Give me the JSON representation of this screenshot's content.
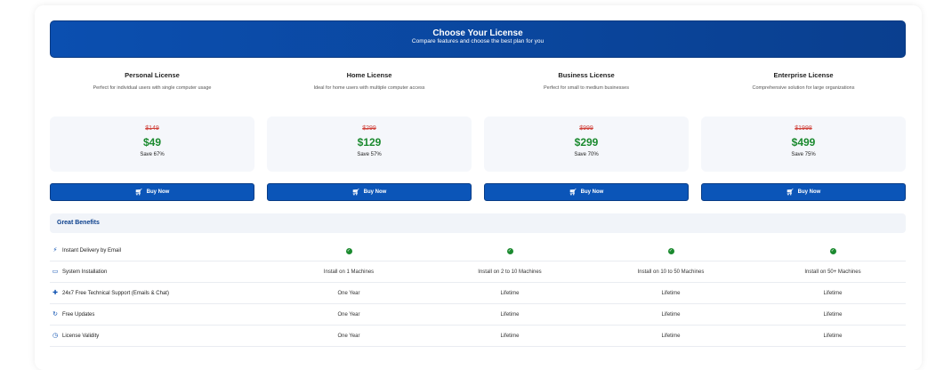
{
  "header": {
    "title": "Choose Your License",
    "subtitle": "Compare features and choose the best plan for you"
  },
  "plans": [
    {
      "name": "Personal License",
      "desc": "Perfect for individual users with single computer usage",
      "old_price": "$149",
      "price": "$49",
      "save": "Save 67%",
      "button": "Buy Now"
    },
    {
      "name": "Home License",
      "desc": "Ideal for home users with multiple computer access",
      "old_price": "$299",
      "price": "$129",
      "save": "Save 57%",
      "button": "Buy Now"
    },
    {
      "name": "Business License",
      "desc": "Perfect for small to medium businesses",
      "old_price": "$999",
      "price": "$299",
      "save": "Save 70%",
      "button": "Buy Now"
    },
    {
      "name": "Enterprise License",
      "desc": "Comprehensive solution for large organizations",
      "old_price": "$1998",
      "price": "$499",
      "save": "Save 75%",
      "button": "Buy Now"
    }
  ],
  "benefits": {
    "title": "Great Benefits",
    "rows": [
      {
        "icon": "bolt-icon",
        "label": "Instant Delivery by Email",
        "values": [
          "check",
          "check",
          "check",
          "check"
        ]
      },
      {
        "icon": "monitor-icon",
        "label": "System Installation",
        "values": [
          "Install on 1 Machines",
          "Install on 2 to 10 Machines",
          "Install on 10 to 50 Machines",
          "Install on 50+ Machines"
        ]
      },
      {
        "icon": "support-icon",
        "label": "24x7 Free Technical Support (Emails & Chat)",
        "values": [
          "One Year",
          "Lifetime",
          "Lifetime",
          "Lifetime"
        ]
      },
      {
        "icon": "refresh-icon",
        "label": "Free Updates",
        "values": [
          "One Year",
          "Lifetime",
          "Lifetime",
          "Lifetime"
        ]
      },
      {
        "icon": "clock-icon",
        "label": "License Validity",
        "values": [
          "One Year",
          "Lifetime",
          "Lifetime",
          "Lifetime"
        ]
      }
    ]
  },
  "colors": {
    "accent": "#0b55b8",
    "price": "#1b8a2f",
    "old_price": "#d0413a"
  }
}
